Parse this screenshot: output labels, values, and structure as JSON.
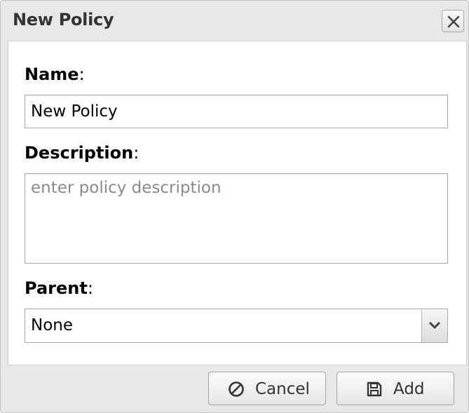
{
  "dialog": {
    "title": "New Policy",
    "close_icon": "close-icon"
  },
  "form": {
    "name_label": "Name",
    "name_value": "New Policy",
    "description_label": "Description",
    "description_value": "",
    "description_placeholder": "enter policy description",
    "parent_label": "Parent",
    "parent_selected": "None",
    "label_suffix": ":"
  },
  "buttons": {
    "cancel_label": "Cancel",
    "cancel_icon": "ban-icon",
    "add_label": "Add",
    "add_icon": "save-icon"
  },
  "colors": {
    "dialog_background": "#e8e8e8",
    "panel_background": "#ffffff",
    "title_text": "#333333",
    "placeholder_text": "#8a8a8a"
  }
}
